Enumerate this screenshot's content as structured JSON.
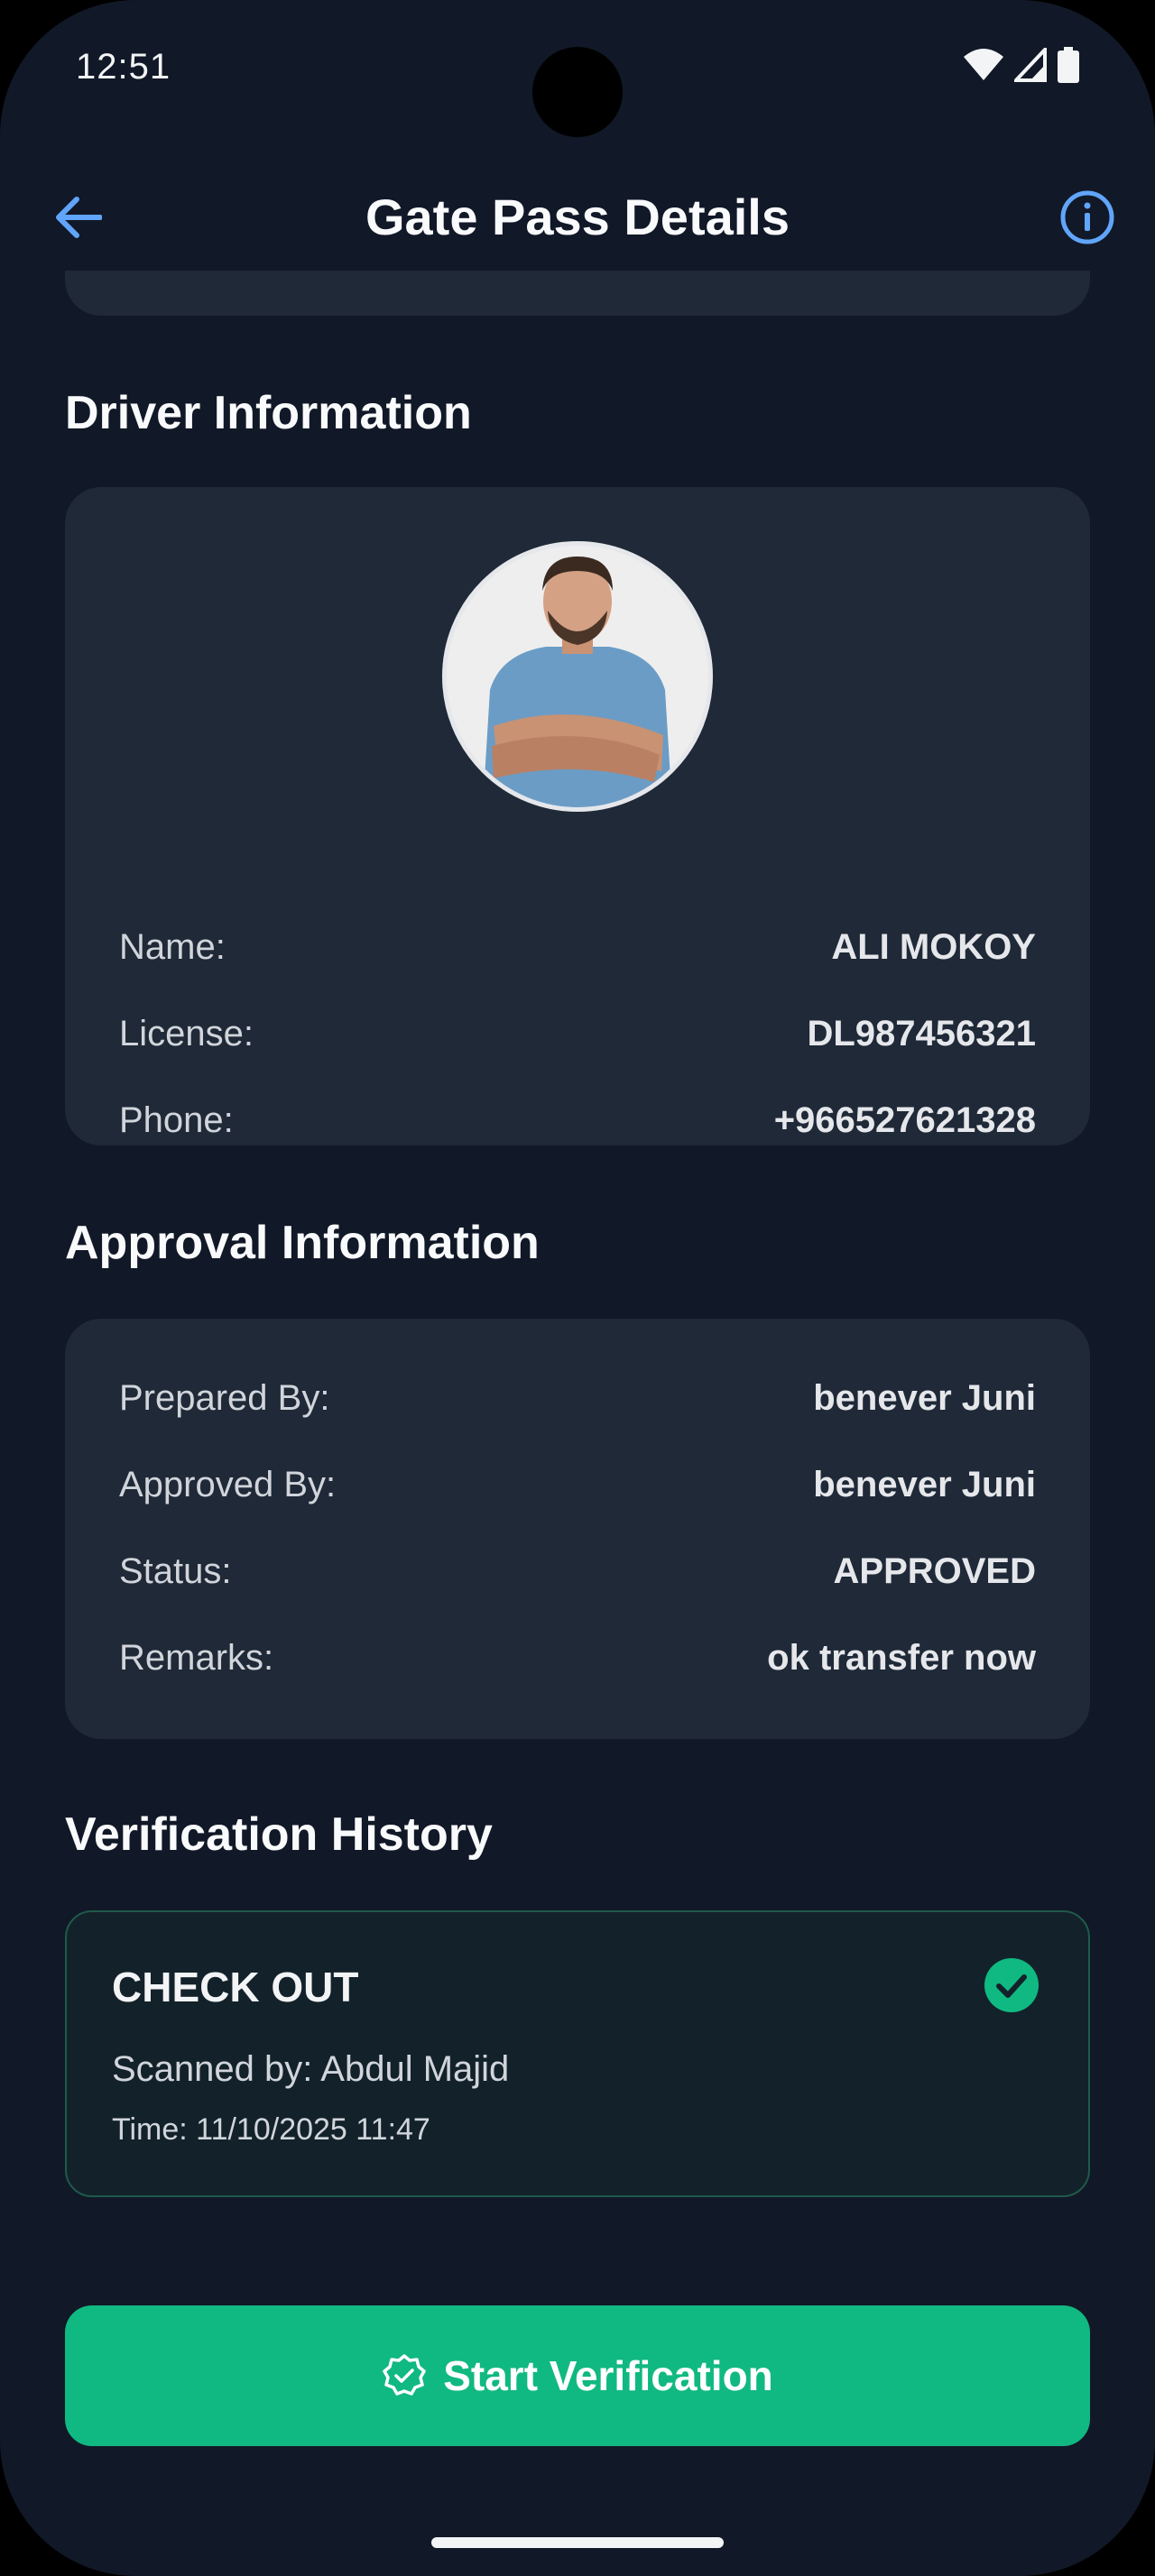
{
  "status_bar": {
    "time": "12:51",
    "icons": [
      "wifi-icon",
      "signal-icon",
      "battery-icon"
    ]
  },
  "app_bar": {
    "title": "Gate Pass Details",
    "back_icon": "arrow-left-icon",
    "info_icon": "info-icon"
  },
  "driver": {
    "section_title": "Driver Information",
    "rows": [
      {
        "label": "Name:",
        "value": "ALI MOKOY"
      },
      {
        "label": "License:",
        "value": "DL987456321"
      },
      {
        "label": "Phone:",
        "value": "+966527621328"
      }
    ]
  },
  "approval": {
    "section_title": "Approval Information",
    "rows": [
      {
        "label": "Prepared By:",
        "value": "benever Juni"
      },
      {
        "label": "Approved By:",
        "value": "benever Juni"
      },
      {
        "label": "Status:",
        "value": "APPROVED"
      },
      {
        "label": "Remarks:",
        "value": "ok transfer now"
      }
    ]
  },
  "history": {
    "section_title": "Verification History",
    "entries": [
      {
        "type": "CHECK OUT",
        "scanned_by": "Scanned by: Abdul Majid",
        "time": "Time: 11/10/2025 11:47"
      }
    ]
  },
  "actions": {
    "start_verification": "Start Verification"
  },
  "colors": {
    "background": "#111827",
    "card": "#1f2937",
    "accent_blue": "#3b82f6",
    "accent_green": "#10b981"
  }
}
